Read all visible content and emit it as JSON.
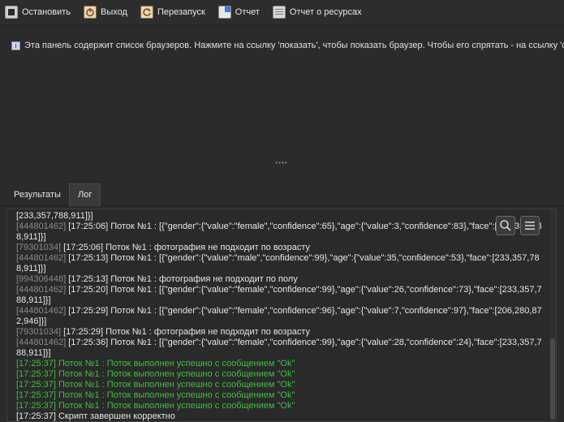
{
  "toolbar": {
    "stop_label": "Остановить",
    "exit_label": "Выход",
    "restart_label": "Перезапуск",
    "report_label": "Отчет",
    "resources_label": "Отчет о ресурсах"
  },
  "info": {
    "text": "Эта панель содержит список браузеров. Нажмите на ссылку 'показать', чтобы показать браузер. Чтобы его спрятать - на ссылку 'спрятать'."
  },
  "tabs": [
    {
      "label": "Результаты"
    },
    {
      "label": "Лог"
    }
  ],
  "log": {
    "lines": [
      {
        "id": "",
        "text": "[233,357,788,911]}]"
      },
      {
        "id": "[444801462]",
        "text": " [17:25:06] Поток №1 : [{\"gender\":{\"value\":\"female\",\"confidence\":65},\"age\":{\"value\":3,\"confidence\":83},\"face\":[233,357,788,911]}]"
      },
      {
        "id": "[79301034]",
        "text": " [17:25:06] Поток №1 : фотография не подходит по возрасту"
      },
      {
        "id": "[444801462]",
        "text": " [17:25:13] Поток №1 : [{\"gender\":{\"value\":\"male\",\"confidence\":99},\"age\":{\"value\":35,\"confidence\":53},\"face\":[233,357,788,911]}]"
      },
      {
        "id": "[994306448]",
        "text": " [17:25:13] Поток №1 : фотография не подходит по полу"
      },
      {
        "id": "[444801462]",
        "text": " [17:25:20] Поток №1 : [{\"gender\":{\"value\":\"female\",\"confidence\":99},\"age\":{\"value\":26,\"confidence\":73},\"face\":[233,357,788,911]}]"
      },
      {
        "id": "[444801462]",
        "text": " [17:25:29] Поток №1 : [{\"gender\":{\"value\":\"female\",\"confidence\":96},\"age\":{\"value\":7,\"confidence\":97},\"face\":[206,280,872,946]}]"
      },
      {
        "id": "[79301034]",
        "text": " [17:25:29] Поток №1 : фотография не подходит по возрасту"
      },
      {
        "id": "[444801462]",
        "text": " [17:25:36] Поток №1 : [{\"gender\":{\"value\":\"female\",\"confidence\":99},\"age\":{\"value\":28,\"confidence\":24},\"face\":[233,357,788,911]}]"
      },
      {
        "id": "",
        "text": "[17:25:37] Поток №1 : Поток выполнен успешно с сообщением \"Ok\"",
        "ok": true
      },
      {
        "id": "",
        "text": "[17:25:37] Поток №1 : Поток выполнен успешно с сообщением \"Ok\"",
        "ok": true
      },
      {
        "id": "",
        "text": "[17:25:37] Поток №1 : Поток выполнен успешно с сообщением \"Ok\"",
        "ok": true
      },
      {
        "id": "",
        "text": "[17:25:37] Поток №1 : Поток выполнен успешно с сообщением \"Ok\"",
        "ok": true
      },
      {
        "id": "",
        "text": "[17:25:37] Поток №1 : Поток выполнен успешно с сообщением \"Ok\"",
        "ok": true
      },
      {
        "id": "",
        "text": "[17:25:37] Скрипт завершен корректно"
      }
    ]
  },
  "colors": {
    "background": "#2b2b2b",
    "success_text": "#3fbf3f",
    "thread_id_text": "#8a8a8a"
  },
  "icons": {
    "stop": "stop-icon",
    "exit": "exit-icon",
    "restart": "restart-icon",
    "report": "report-pie-icon",
    "resources": "resources-report-icon",
    "search": "search-icon",
    "menu": "menu-icon"
  }
}
